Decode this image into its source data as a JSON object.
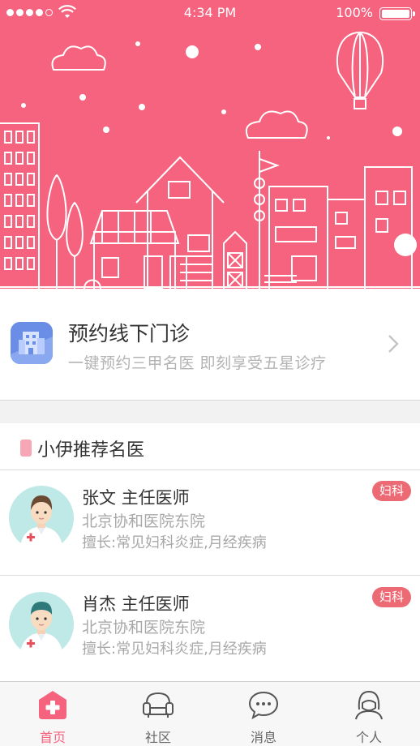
{
  "status_bar": {
    "time": "4:34 PM",
    "battery": "100%"
  },
  "appointment": {
    "title": "预约线下门诊",
    "subtitle": "一键预约三甲名医  即刻享受五星诊疗",
    "icon": "hospital-building-icon"
  },
  "section": {
    "title": "小伊推荐名医"
  },
  "doctors": [
    {
      "name": "张文 主任医师",
      "hospital": "北京协和医院东院",
      "skill": "擅长:常见妇科炎症,月经疾病",
      "department": "妇科"
    },
    {
      "name": "肖杰 主任医师",
      "hospital": "北京协和医院东院",
      "skill": "擅长:常见妇科炎症,月经疾病",
      "department": "妇科"
    }
  ],
  "tabs": [
    {
      "label": "首页",
      "icon": "home-medical-icon",
      "active": true
    },
    {
      "label": "社区",
      "icon": "community-sofa-icon",
      "active": false
    },
    {
      "label": "消息",
      "icon": "message-bubble-icon",
      "active": false
    },
    {
      "label": "个人",
      "icon": "profile-person-icon",
      "active": false
    }
  ],
  "colors": {
    "brand": "#f5637f",
    "badge": "#ec6a74",
    "appointment_icon": "#6a8ee6"
  }
}
